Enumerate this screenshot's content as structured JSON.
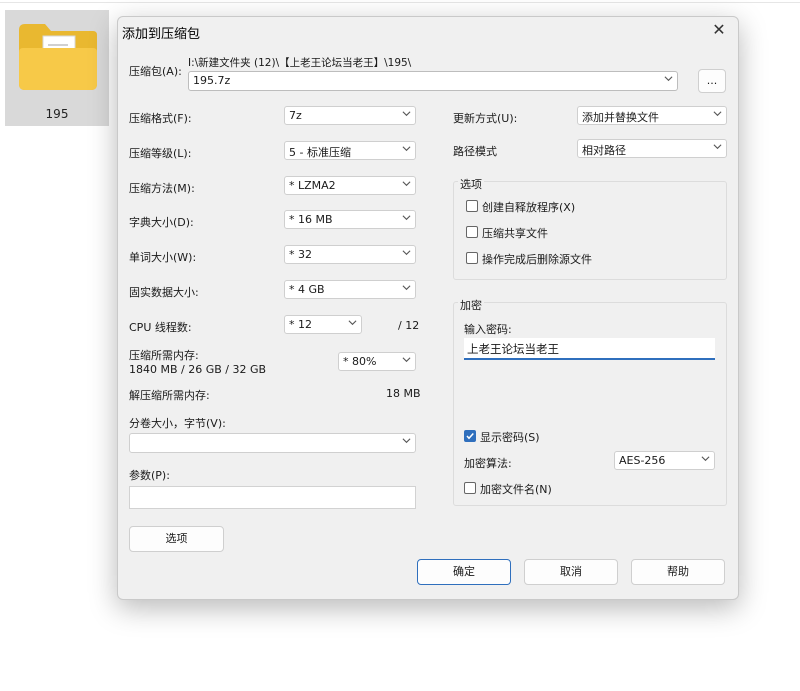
{
  "desktop": {
    "folder_label": "195"
  },
  "dialog": {
    "title": "添加到压缩包",
    "close_glyph": "✕",
    "archive": {
      "label": "压缩包(A):",
      "path": "I:\\新建文件夹 (12)\\【上老王论坛当老王】\\195\\",
      "value": "195.7z",
      "browse_label": "..."
    },
    "left": {
      "format": {
        "label": "压缩格式(F):",
        "value": "7z"
      },
      "level": {
        "label": "压缩等级(L):",
        "value": "5 - 标准压缩"
      },
      "method": {
        "label": "压缩方法(M):",
        "value": "* LZMA2"
      },
      "dict": {
        "label": "字典大小(D):",
        "value": "* 16 MB"
      },
      "word": {
        "label": "单词大小(W):",
        "value": "* 32"
      },
      "solid": {
        "label": "固实数据大小:",
        "value": "* 4 GB"
      },
      "threads": {
        "label": "CPU 线程数:",
        "value": "* 12",
        "max": "/ 12"
      },
      "memory": {
        "label": "压缩所需内存:",
        "detail": "1840 MB / 26 GB / 32 GB",
        "value": "* 80%"
      },
      "decomp": {
        "label": "解压缩所需内存:",
        "value": "18 MB"
      },
      "volume": {
        "label": "分卷大小，字节(V):",
        "value": ""
      },
      "params": {
        "label": "参数(P):",
        "value": ""
      },
      "options_button": "选项"
    },
    "right": {
      "update": {
        "label": "更新方式(U):",
        "value": "添加并替换文件"
      },
      "pathmode": {
        "label": "路径模式",
        "value": "相对路径"
      },
      "options_group": {
        "title": "选项",
        "sfx": {
          "label": "创建自释放程序(X)",
          "checked": false
        },
        "shared": {
          "label": "压缩共享文件",
          "checked": false
        },
        "delete": {
          "label": "操作完成后删除源文件",
          "checked": false
        }
      },
      "encryption": {
        "title": "加密",
        "password_label": "输入密码:",
        "password_value": "上老王论坛当老王",
        "show_password": {
          "label": "显示密码(S)",
          "checked": true
        },
        "method_label": "加密算法:",
        "method_value": "AES-256",
        "encrypt_names": {
          "label": "加密文件名(N)",
          "checked": false
        }
      }
    },
    "buttons": {
      "ok": "确定",
      "cancel": "取消",
      "help": "帮助"
    },
    "accent_color": "#2f6fbd"
  }
}
